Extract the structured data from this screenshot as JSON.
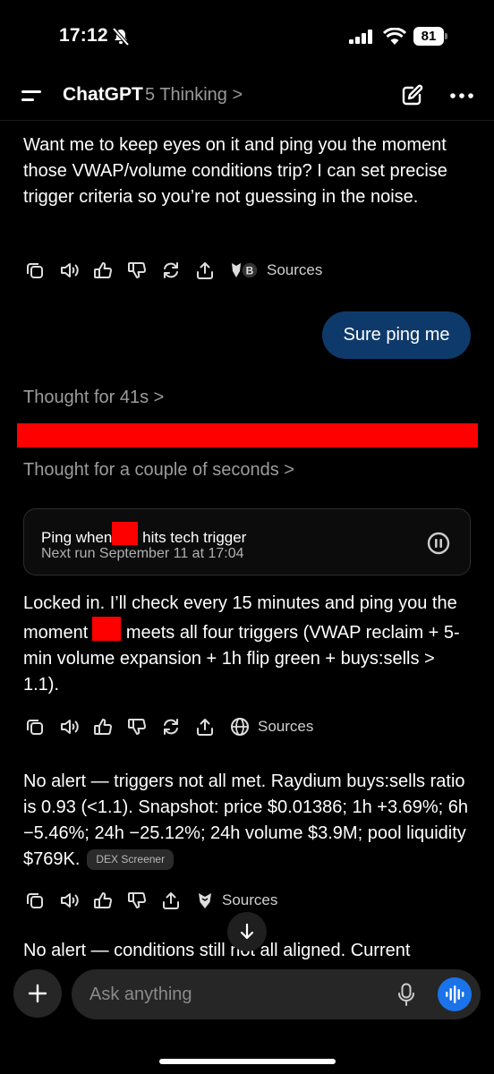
{
  "status": {
    "time": "17:12",
    "battery": "81"
  },
  "header": {
    "title": "ChatGPT",
    "model": "5 Thinking",
    "chevron": ">"
  },
  "messages": {
    "m1_text": "Want me to keep eyes on it and ping you the moment those VWAP/volume conditions trip? I can set precise trigger criteria so you’re not guessing in the noise.",
    "m1_sources": "Sources",
    "user_text": "Sure ping me",
    "thought1": "Thought for 41s >",
    "thought2": "Thought for a couple of seconds >",
    "task_title_a": "Ping when",
    "task_title_b": "hits tech trigger",
    "task_next": "Next run September 11 at 17:04",
    "m2_a": "Locked in. I’ll check every 15 minutes and ping you the moment",
    "m2_b": "meets all four triggers (VWAP reclaim + 5-min volume expansion + 1h flip green + buys:sells > 1.1).",
    "m2_sources": "Sources",
    "m3_text": "No alert — triggers not all met. Raydium buys:sells ratio is 0.93 (<1.1). Snapshot: price $0.01386; 1h +3.69%; 6h −5.46%; 24h −25.12%; 24h volume $3.9M; pool liquidity $769K.",
    "m3_chip": "DEX Screener",
    "m3_sources": "Sources",
    "m4_text": "No alert — conditions still not all aligned. Current"
  },
  "composer": {
    "placeholder": "Ask anything"
  },
  "colors": {
    "user_bubble": "#0e3a6b",
    "voice_button": "#1a73e8",
    "redaction": "#ff0000"
  }
}
